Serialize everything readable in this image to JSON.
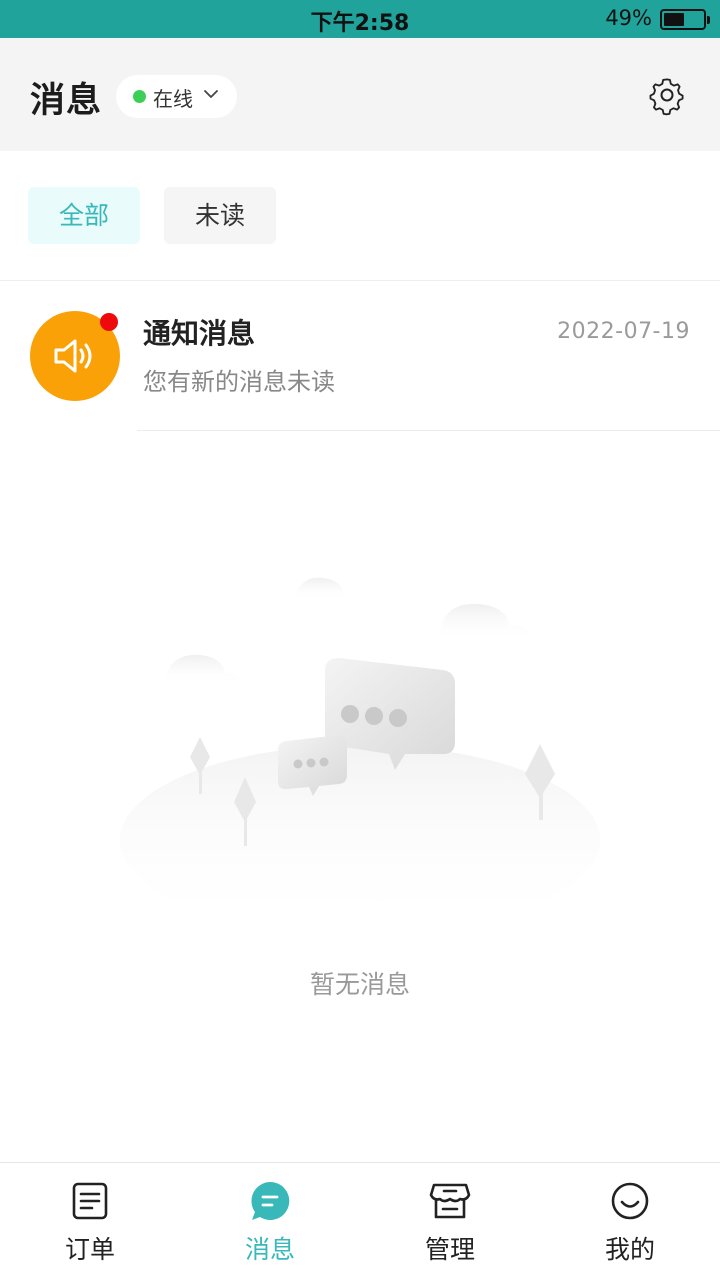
{
  "status_bar": {
    "time": "下午2:58",
    "battery": "49%",
    "battery_level": 0.49
  },
  "header": {
    "title": "消息",
    "online_status": {
      "label": "在线",
      "dot_color": "#3ccf55"
    },
    "settings_icon": "gear-icon"
  },
  "filters": [
    {
      "label": "全部",
      "selected": true
    },
    {
      "label": "未读",
      "selected": false
    }
  ],
  "messages": [
    {
      "title": "通知消息",
      "subtitle": "您有新的消息未读",
      "date": "2022-07-19",
      "icon": "speaker-icon",
      "icon_bg": "#fba108",
      "unread": true
    }
  ],
  "empty_state": {
    "text": "暂无消息",
    "illustration": "chat-bubbles-illustration"
  },
  "tabbar": [
    {
      "label": "订单",
      "icon": "order-document-icon",
      "active": false
    },
    {
      "label": "消息",
      "icon": "message-bubble-icon",
      "active": true
    },
    {
      "label": "管理",
      "icon": "store-icon",
      "active": false
    },
    {
      "label": "我的",
      "icon": "smile-face-icon",
      "active": false
    }
  ],
  "colors": {
    "accent": "#38b8b9",
    "status_bar": "#1fa39a",
    "unread_badge": "#ee0a0a"
  }
}
